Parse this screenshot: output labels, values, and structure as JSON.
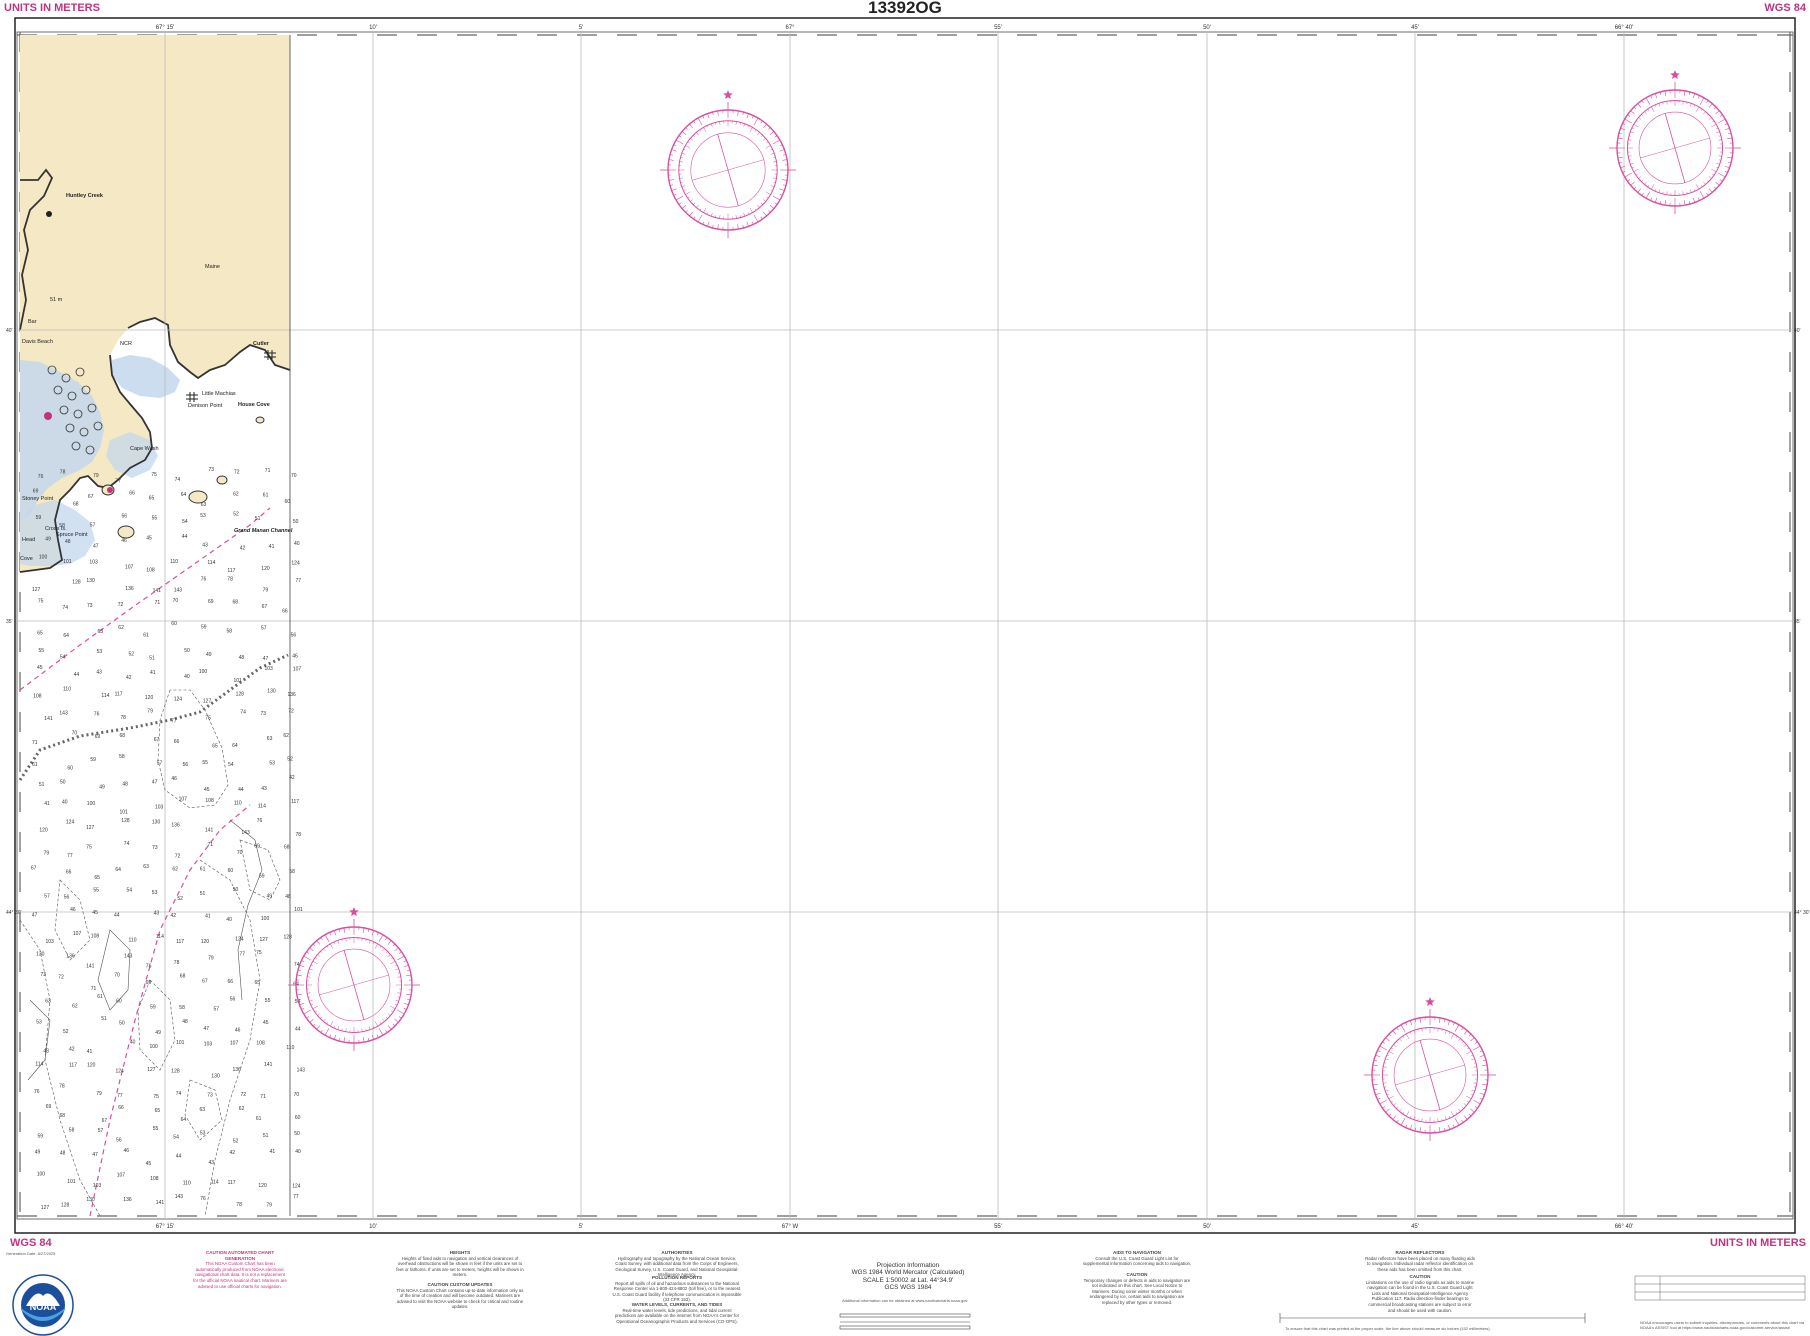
{
  "header": {
    "chart_number": "13392OG",
    "left_label": "UNITS IN METERS",
    "right_label": "WGS 84"
  },
  "footer": {
    "left_label": "WGS 84",
    "right_label": "UNITS IN METERS",
    "generation": "Generation Date: 8/27/2025",
    "scale_bar_note": "To ensure that this chart was printed at the proper scale, the line above should measure six inches (152 millimeters).",
    "website_note": "Additional information can be obtained at www.nauticalcharts.noaa.gov.",
    "feedback_note": "NOAA encourages users to submit inquiries, discrepancies, or comments about this chart via NOAA's ASSIST tool at https://www.nauticalcharts.noaa.gov/customer-service/assist/"
  },
  "projection": {
    "line1": "Projection Information",
    "line2": "WGS 1984 World Mercator (Calculated)",
    "line3": "SCALE 1:50002 at Lat. 44°34.9'",
    "line4": "GCS WGS 1984"
  },
  "notes": {
    "caution_custom": {
      "title": "CAUTION AUTOMATED CHART GENERATION",
      "body": "This NOAA Custom Chart has been automatically produced from NOAA electronic navigational chart data. It is not a replacement for the official NOAA nautical chart. Mariners are advised to use official charts for navigation."
    },
    "heights": {
      "title": "HEIGHTS",
      "body": "Heights of fixed aids to navigation and vertical clearances of overhead obstructions will be shown in feet if the units are set to feet or fathoms. If units are set to meters, heights will be shown in meters."
    },
    "caution_updates": {
      "title": "CAUTION CUSTOM UPDATES",
      "body": "This NOAA Custom Chart contains up-to-date information only as of the time of creation and will become outdated. Mariners are advised to visit the NOAA website to check for critical and routine updates."
    },
    "authorities": {
      "title": "AUTHORITIES",
      "body": "Hydrography and topography by the National Ocean Service, Coast Survey, with additional data from the Corps of Engineers, Geological Survey, U.S. Coast Guard, and National Geospatial-Intelligence Agency."
    },
    "pollution": {
      "title": "POLLUTION REPORTS",
      "body": "Report all spills of oil and hazardous substances to the National Response Center via 1-800-424-8802 (toll free), or to the nearest U.S. Coast Guard facility if telephone communication is impossible (33 CFR 153)."
    },
    "water_levels": {
      "title": "WATER LEVELS, CURRENTS, AND TIDES",
      "body": "Real-time water levels, tide predictions, and tidal current predictions are available on the internet from NOAA's Center for Operational Oceanographic Products and Services (CO-OPS)."
    },
    "aids": {
      "title": "AIDS TO NAVIGATION",
      "body": "Consult the U.S. Coast Guard Light List for supplemental information concerning aids to navigation."
    },
    "caution_aids": {
      "title": "CAUTION",
      "body": "Temporary changes or defects in aids to navigation are not indicated on this chart. See Local Notice to Mariners. During some winter months or when endangered by ice, certain aids to navigation are replaced by other types or removed."
    },
    "radar": {
      "title": "RADAR REFLECTORS",
      "body": "Radar reflectors have been placed on many floating aids to navigation. Individual radar reflector identification on these aids has been omitted from this chart."
    },
    "caution_radio": {
      "title": "CAUTION",
      "body": "Limitations on the use of radio signals as aids to marine navigation can be found in the U.S. Coast Guard Light Lists and National Geospatial-Intelligence Agency Publication 117. Radio direction-finder bearings to commercial broadcasting stations are subject to error and should be used with caution."
    }
  },
  "land_labels": [
    {
      "name": "Maine"
    },
    {
      "name": "Huntley Creek"
    },
    {
      "name": "Davis Beach"
    },
    {
      "name": "Cutler"
    },
    {
      "name": "Denison Point"
    },
    {
      "name": "House Cove"
    },
    {
      "name": "Little Machias"
    },
    {
      "name": "Cape Wash"
    },
    {
      "name": "Grand Manan Channel"
    },
    {
      "name": "Spruce Point"
    },
    {
      "name": "Cross Is."
    },
    {
      "name": "Stoney Point"
    },
    {
      "name": "Head"
    },
    {
      "name": "Cove"
    },
    {
      "name": "NCR"
    },
    {
      "name": "Bar"
    },
    {
      "name": "51 m"
    }
  ],
  "graticule": {
    "top_longitudes": [
      "67° 15'",
      "10'",
      "5'",
      "67°",
      "55'",
      "50'",
      "45'",
      "66° 40'"
    ],
    "bottom_longitudes": [
      "67° 15'",
      "10'",
      "5'",
      "67° W",
      "55'",
      "50'",
      "45'",
      "66° 40'"
    ],
    "left_latitudes": [
      "40'",
      "35'",
      "44° 30'"
    ],
    "right_latitudes": [
      "40'",
      "35'",
      "44° 30'"
    ]
  },
  "soundings": [
    "76",
    "78",
    "79",
    "77",
    "75",
    "74",
    "73",
    "72",
    "71",
    "70",
    "69",
    "68",
    "67",
    "66",
    "65",
    "64",
    "63",
    "62",
    "61",
    "60",
    "59",
    "58",
    "57",
    "56",
    "55",
    "54",
    "53",
    "52",
    "51",
    "50",
    "49",
    "48",
    "47",
    "46",
    "45",
    "44",
    "43",
    "42",
    "41",
    "40",
    "100",
    "101",
    "103",
    "107",
    "108",
    "110",
    "114",
    "117",
    "120",
    "124",
    "127",
    "128",
    "130",
    "136",
    "141",
    "143"
  ],
  "colors": {
    "land": "#f5e8c4",
    "shallow_water": "#c3d7ec",
    "magenta": "#c0347f",
    "border": "#222222"
  },
  "logo": {
    "name": "NOAA",
    "ring_text": "NATIONAL OCEANIC AND ATMOSPHERIC ADMINISTRATION"
  }
}
